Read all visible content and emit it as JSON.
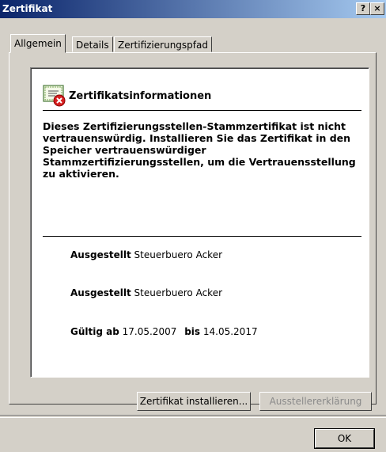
{
  "window": {
    "title": "Zertifikat",
    "help_button": "?",
    "close_button": "×"
  },
  "tabs": [
    {
      "label": "Allgemein",
      "active": true
    },
    {
      "label": "Details",
      "active": false
    },
    {
      "label": "Zertifizierungspfad",
      "active": false
    }
  ],
  "info": {
    "heading": "Zertifikatsinformationen",
    "icon": "certificate-error-icon",
    "message": "Dieses Zertifizierungsstellen-Stammzertifikat ist nicht vertrauenswürdig. Installieren Sie das Zertifikat in den Speicher vertrauenswürdiger Stammzertifizierungsstellen, um die Vertrauensstellung zu aktivieren."
  },
  "fields": {
    "issued_to_label": "Ausgestellt",
    "issued_to_value": "Steuerbuero Acker",
    "issued_by_label": "Ausgestellt",
    "issued_by_value": "Steuerbuero Acker",
    "valid_from_label": "Gültig ab",
    "valid_from_value": "17.05.2007",
    "valid_to_label": "bis",
    "valid_to_value": "14.05.2017"
  },
  "buttons": {
    "install": "Zertifikat installieren...",
    "issuer_statement": "Ausstellererklärung",
    "ok": "OK"
  },
  "colors": {
    "titlebar_start": "#0a246a",
    "titlebar_end": "#a6caf0",
    "dialog_bg": "#d4d0c8",
    "error_red": "#d62020"
  }
}
